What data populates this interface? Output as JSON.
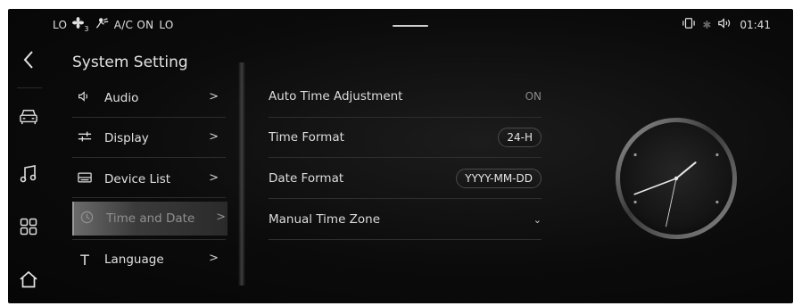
{
  "status_bar": {
    "temp_left": "LO",
    "fan_icon": "fan-icon",
    "fan_level": "3",
    "ac_label": "A/C ON",
    "temp_right": "LO",
    "time": "01:41"
  },
  "left_rail": {
    "back_icon": "chevron-left-icon",
    "icons": [
      "car-icon",
      "music-icon",
      "apps-grid-icon",
      "home-icon"
    ]
  },
  "settings_menu": {
    "title": "System Setting",
    "items": [
      {
        "label": "Audio",
        "icon": "speaker-icon"
      },
      {
        "label": "Display",
        "icon": "sliders-icon"
      },
      {
        "label": "Device List",
        "icon": "device-list-icon"
      },
      {
        "label": "Time and Date",
        "icon": "clock-icon",
        "active": true
      },
      {
        "label": "Language",
        "icon": "text-icon"
      }
    ]
  },
  "time_date": {
    "auto_adjust": {
      "label": "Auto Time Adjustment",
      "value": "ON"
    },
    "time_format": {
      "label": "Time Format",
      "value": "24-H"
    },
    "date_format": {
      "label": "Date Format",
      "value": "YYYY-MM-DD"
    },
    "time_zone": {
      "label": "Manual Time Zone"
    }
  },
  "clock": {
    "hour": 1,
    "minute": 41,
    "second": 32
  },
  "colors": {
    "background": "#0b0b0b",
    "text": "#dcdcdc",
    "active_text": "#8f8f8f"
  }
}
